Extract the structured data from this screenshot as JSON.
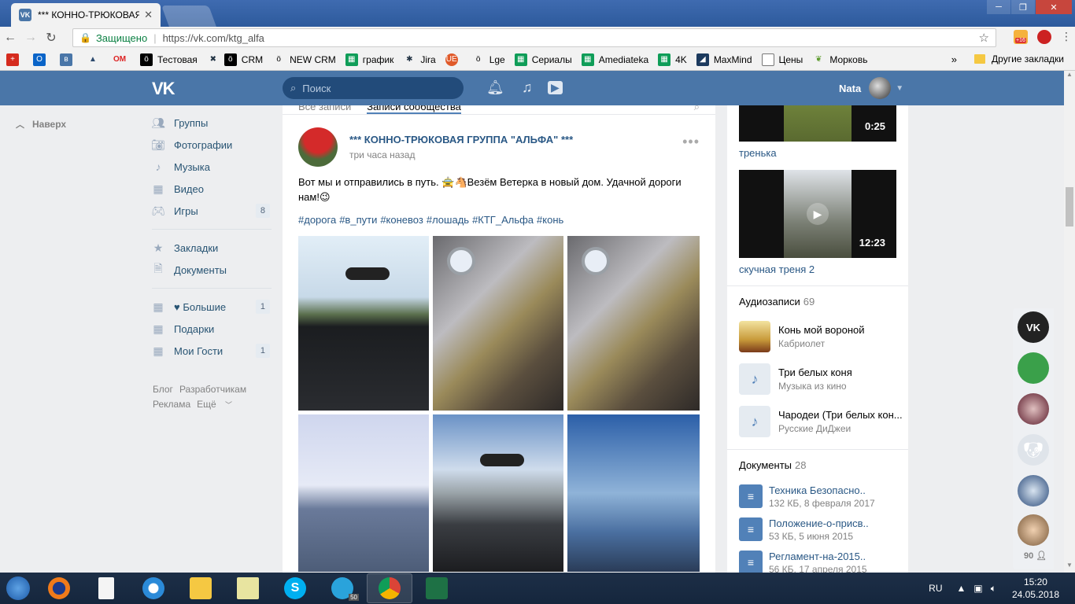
{
  "browser": {
    "tab_title": "*** КОННО-ТРЮКОВАЯ Г",
    "secure_label": "Защищено",
    "url": "https://vk.com/ktg_alfa",
    "ext_badge": "+16",
    "bookmarks": [
      "Тестовая",
      "CRM",
      "NEW CRM",
      "график",
      "Jira",
      "Lge",
      "Сериалы",
      "Amediateka",
      "4K",
      "MaxMind",
      "Цены",
      "Морковь"
    ],
    "other_bookmarks": "Другие закладки"
  },
  "vk_header": {
    "search_placeholder": "Поиск",
    "user_name": "Nata"
  },
  "left_menu": {
    "to_top": "Наверх",
    "items": [
      {
        "label": "Группы",
        "icon": "groups-icon",
        "count": ""
      },
      {
        "label": "Фотографии",
        "icon": "camera-icon",
        "count": ""
      },
      {
        "label": "Музыка",
        "icon": "music-icon",
        "count": ""
      },
      {
        "label": "Видео",
        "icon": "video-icon",
        "count": ""
      },
      {
        "label": "Игры",
        "icon": "gamepad-icon",
        "count": "8"
      }
    ],
    "items2": [
      {
        "label": "Закладки",
        "icon": "star-icon"
      },
      {
        "label": "Документы",
        "icon": "document-icon"
      }
    ],
    "apps": [
      {
        "label": "♥ Большие",
        "count": "1"
      },
      {
        "label": "Подарки",
        "count": ""
      },
      {
        "label": "Мои Гости",
        "count": "1"
      }
    ],
    "footer": [
      "Блог",
      "Разработчикам",
      "Реклама",
      "Ещё"
    ]
  },
  "feed": {
    "tab_all": "Все записи",
    "tab_community": "Записи сообщества",
    "post": {
      "author": "*** КОННО-ТРЮКОВАЯ ГРУППА \"АЛЬФА\" ***",
      "time": "три часа назад",
      "text": "Вот мы и отправились в путь. 🚖🐴Везём Ветерка в новый дом. Удачной дороги нам!😉",
      "tags": [
        "#дорога",
        "#в_пути",
        "#коневоз",
        "#лошадь",
        "#КТГ_Альфа",
        "#конь"
      ]
    }
  },
  "right": {
    "videos": [
      {
        "duration": "0:25",
        "title": "тренька"
      },
      {
        "duration": "12:23",
        "title": "скучная треня 2"
      }
    ],
    "audio_label": "Аудиозаписи",
    "audio_count": "69",
    "audios": [
      {
        "title": "Конь мой вороной",
        "artist": "Кабриолет"
      },
      {
        "title": "Три белых коня",
        "artist": "Музыка из кино"
      },
      {
        "title": "Чародеи (Три белых кон...",
        "artist": "Русские ДиДжеи"
      }
    ],
    "docs_label": "Документы",
    "docs_count": "28",
    "docs": [
      {
        "title": "Техника Безопасно..",
        "meta": "132 КБ, 8 февраля 2017"
      },
      {
        "title": "Положение-о-присв..",
        "meta": "53 КБ, 5 июня 2015"
      },
      {
        "title": "Регламент-на-2015..",
        "meta": "56 КБ, 17 апреля 2015"
      }
    ]
  },
  "chatbar": {
    "online_count": "90"
  },
  "taskbar": {
    "lang": "RU",
    "time": "15:20",
    "date": "24.05.2018",
    "telegram_badge": "50"
  }
}
